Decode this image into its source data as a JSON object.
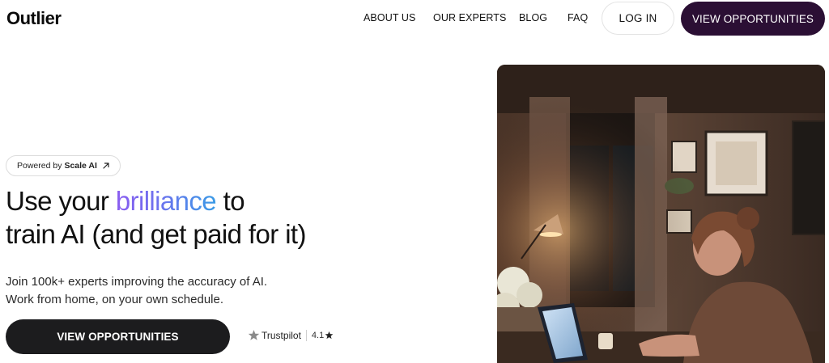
{
  "brand": {
    "logo": "Outlier"
  },
  "nav": {
    "links": [
      "ABOUT US",
      "OUR EXPERTS",
      "BLOG",
      "FAQ"
    ],
    "login": "LOG IN",
    "cta": "VIEW OPPORTUNITIES"
  },
  "hero": {
    "pill_prefix": "Powered by",
    "pill_brand": "Scale AI",
    "headline_pre": "Use your ",
    "headline_highlight": "brilliance",
    "headline_post": " to",
    "headline_line2": "train AI (and get paid for it)",
    "sub_line1": "Join 100k+ experts improving the accuracy of AI.",
    "sub_line2": "Work from home, on your own schedule.",
    "cta": "VIEW OPPORTUNITIES",
    "trustpilot_label": "Trustpilot",
    "trustpilot_rating": "4.1"
  },
  "colors": {
    "nav_cta_bg": "#2b0f34",
    "hero_cta_bg": "#1c1c1e",
    "gradient_start": "#8a5cf0",
    "gradient_end": "#3a9be6"
  },
  "icons": {
    "pill_arrow": "arrow-up-right-icon",
    "trustpilot": "trustpilot-star-icon",
    "rating": "star-icon"
  }
}
